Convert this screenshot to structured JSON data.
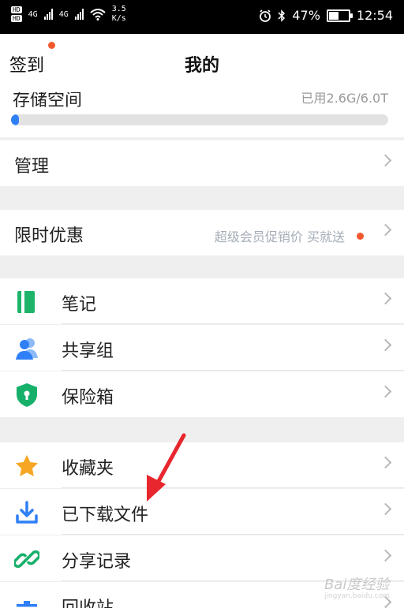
{
  "status_bar": {
    "hd_1": "HD",
    "hd_2": "HD",
    "net_1": "4G",
    "net_2": "4G",
    "speed_value": "3.5",
    "speed_unit": "K/s",
    "battery": "47%",
    "time": "12:54"
  },
  "header": {
    "sign_in": "签到",
    "title": "我的"
  },
  "storage": {
    "label": "存储空间",
    "used": "已用2.6G/6.0T",
    "used_fraction": 0.02
  },
  "rows": {
    "manage": "管理",
    "limited_offer": "限时优惠",
    "limited_offer_promo": "超级会员促销价 买就送",
    "notes": "笔记",
    "shared_group": "共享组",
    "safe_box": "保险箱",
    "favorites": "收藏夹",
    "downloaded_files": "已下载文件",
    "share_history": "分享记录",
    "recycle_bin": "回收站"
  },
  "watermark": {
    "brand": "Bai度经验",
    "site": "jingyan.baidu.com"
  },
  "colors": {
    "accent_blue": "#2f7ff7",
    "notify_dot": "#f1582d",
    "notes_green": "#1db46a",
    "group_blue": "#2f7ff7",
    "safe_green": "#17b06b",
    "star_orange": "#f6a623",
    "arrow_red": "#e8262d"
  }
}
